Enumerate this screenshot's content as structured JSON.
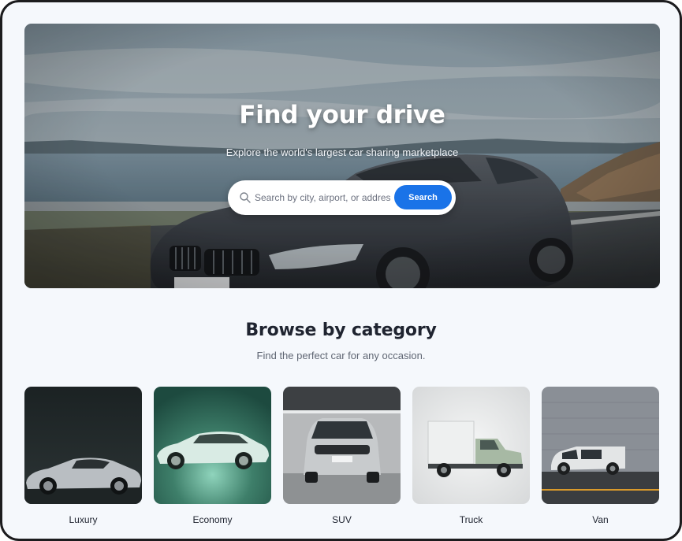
{
  "hero": {
    "title": "Find your drive",
    "subtitle": "Explore the world's largest car sharing marketplace",
    "search": {
      "placeholder": "Search by city, airport, or address",
      "button_label": "Search"
    }
  },
  "categories_section": {
    "title": "Browse by category",
    "subtitle": "Find the perfect car for any occasion.",
    "items": [
      {
        "label": "Luxury"
      },
      {
        "label": "Economy"
      },
      {
        "label": "SUV"
      },
      {
        "label": "Truck"
      },
      {
        "label": "Van"
      }
    ]
  },
  "colors": {
    "accent": "#1a73e8",
    "background": "#f5f8fc",
    "heading": "#1f2430"
  }
}
